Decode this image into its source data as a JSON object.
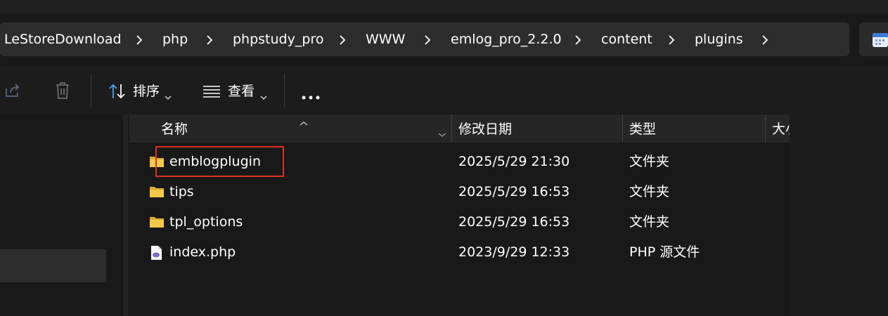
{
  "breadcrumb": {
    "items": [
      "LeStoreDownload",
      "php",
      "phpstudy_pro",
      "WWW",
      "emlog_pro_2.2.0",
      "content",
      "plugins"
    ]
  },
  "toolbar": {
    "sort_label": "排序",
    "view_label": "查看"
  },
  "columns": {
    "name": "名称",
    "modified": "修改日期",
    "type": "类型",
    "size": "大小"
  },
  "files": [
    {
      "name": "emblogplugin",
      "modified": "2025/5/29 21:30",
      "type": "文件夹",
      "icon": "folder-icon"
    },
    {
      "name": "tips",
      "modified": "2025/5/29 16:53",
      "type": "文件夹",
      "icon": "folder-icon"
    },
    {
      "name": "tpl_options",
      "modified": "2025/5/29 16:53",
      "type": "文件夹",
      "icon": "folder-icon"
    },
    {
      "name": "index.php",
      "modified": "2023/9/29 12:33",
      "type": "PHP 源文件",
      "icon": "php-file-icon"
    }
  ],
  "colors": {
    "background": "#191919",
    "addressbar": "#2d2d2d",
    "header": "#262626",
    "highlight": "#e0301e",
    "folder": "#f3c94c"
  }
}
